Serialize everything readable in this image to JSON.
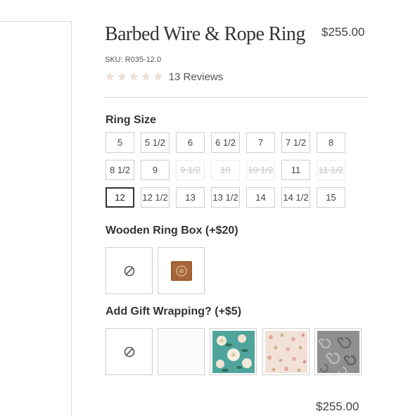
{
  "product": {
    "title": "Barbed Wire & Rope Ring",
    "price": "$255.00",
    "sku": "SKU: R035-12.0",
    "rating_stars": 5,
    "reviews": "13 Reviews"
  },
  "ring_size": {
    "label": "Ring Size",
    "selected": "12",
    "options": [
      {
        "label": "5",
        "available": true
      },
      {
        "label": "5 1/2",
        "available": true
      },
      {
        "label": "6",
        "available": true
      },
      {
        "label": "6 1/2",
        "available": true
      },
      {
        "label": "7",
        "available": true
      },
      {
        "label": "7 1/2",
        "available": true
      },
      {
        "label": "8",
        "available": true
      },
      {
        "label": "8 1/2",
        "available": true
      },
      {
        "label": "9",
        "available": true
      },
      {
        "label": "9 1/2",
        "available": false
      },
      {
        "label": "10",
        "available": false
      },
      {
        "label": "10 1/2",
        "available": false
      },
      {
        "label": "11",
        "available": true
      },
      {
        "label": "11 1/2",
        "available": false
      },
      {
        "label": "12",
        "available": true
      },
      {
        "label": "12 1/2",
        "available": true
      },
      {
        "label": "13",
        "available": true
      },
      {
        "label": "13 1/2",
        "available": true
      },
      {
        "label": "14",
        "available": true
      },
      {
        "label": "14 1/2",
        "available": true
      },
      {
        "label": "15",
        "available": true
      }
    ]
  },
  "ring_box": {
    "label": "Wooden Ring Box (+$20)",
    "options": [
      {
        "name": "no-ring-box",
        "icon": "none-icon"
      },
      {
        "name": "wooden-ring-box",
        "icon": "wooden-box-image"
      }
    ]
  },
  "gift_wrap": {
    "label": "Add Gift Wrapping? (+$5)",
    "options": [
      {
        "name": "no-gift-wrap",
        "icon": "none-icon"
      },
      {
        "name": "white-wrap",
        "icon": "white-paper"
      },
      {
        "name": "teal-floral-wrap",
        "icon": "teal-floral-pattern"
      },
      {
        "name": "pink-floral-wrap",
        "icon": "pink-floral-pattern"
      },
      {
        "name": "gray-swirl-wrap",
        "icon": "gray-swirl-pattern"
      }
    ]
  },
  "footer": {
    "price": "$255.00"
  },
  "colors": {
    "star": "#e9dfd2",
    "border": "#cfcfcf",
    "selected_border": "#333333",
    "disabled_text": "#c6c6c6"
  }
}
